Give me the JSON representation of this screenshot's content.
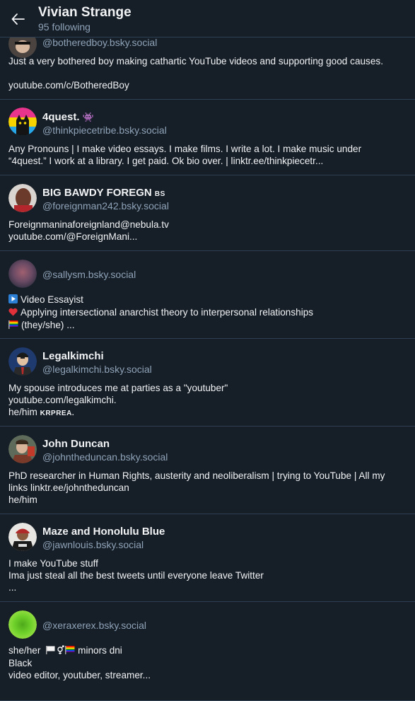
{
  "header": {
    "title": "Vivian Strange",
    "subtitle": "95 following"
  },
  "items": [
    {
      "name": "",
      "handle": "@botheredboy.bsky.social",
      "bio": [
        "Just a very bothered boy making cathartic YouTube videos and supporting good causes.",
        "",
        "youtube.com/c/BotheredBoy"
      ]
    },
    {
      "name": "4quest.",
      "name_badge": "👾",
      "handle": "@thinkpiecetribe.bsky.social",
      "bio": [
        "Any Pronouns | I make video essays. I make films. I write a lot. I make music under",
        "“4quest.” I work at a library. I get paid. Ok bio over. | linktr.ee/thinkpiecetr..."
      ]
    },
    {
      "name": "BIG BAWDY FOREGN",
      "name_badge": "BS",
      "handle": "@foreignman242.bsky.social",
      "bio": [
        "Foreignmaninaforeignland@nebula.tv",
        "youtube.com/@ForeignMani..."
      ]
    },
    {
      "name": "",
      "handle": "@sallysm.bsky.social",
      "bio": [
        "Video Essayist",
        "Applying intersectional anarchist theory to interpersonal relationships",
        "(they/she) ..."
      ]
    },
    {
      "name": "Legalkimchi",
      "handle": "@legalkimchi.bsky.social",
      "bio": [
        "My spouse introduces me at parties as a \"youtuber\"",
        "youtube.com/legalkimchi.",
        "he/him"
      ],
      "bio_badge": "KRPREA."
    },
    {
      "name": "John Duncan",
      "handle": "@johntheduncan.bsky.social",
      "bio": [
        "PhD researcher in Human Rights, austerity and neoliberalism | trying to YouTube | All my",
        "links linktr.ee/johntheduncan",
        "he/him"
      ]
    },
    {
      "name": "Maze and Honolulu Blue",
      "handle": "@jawnlouis.bsky.social",
      "bio": [
        "I make YouTube stuff",
        "Ima just steal all the best tweets until everyone leave Twitter",
        "..."
      ]
    },
    {
      "name": "",
      "handle": "@xeraxerex.bsky.social",
      "bio": [
        "she/her",
        "minors dni",
        "Black",
        "video editor, youtuber, streamer..."
      ]
    }
  ],
  "colors": {
    "background": "#161e27",
    "divider": "#2e4052",
    "muted": "#8fa3b8",
    "text": "#f1f3f5"
  }
}
